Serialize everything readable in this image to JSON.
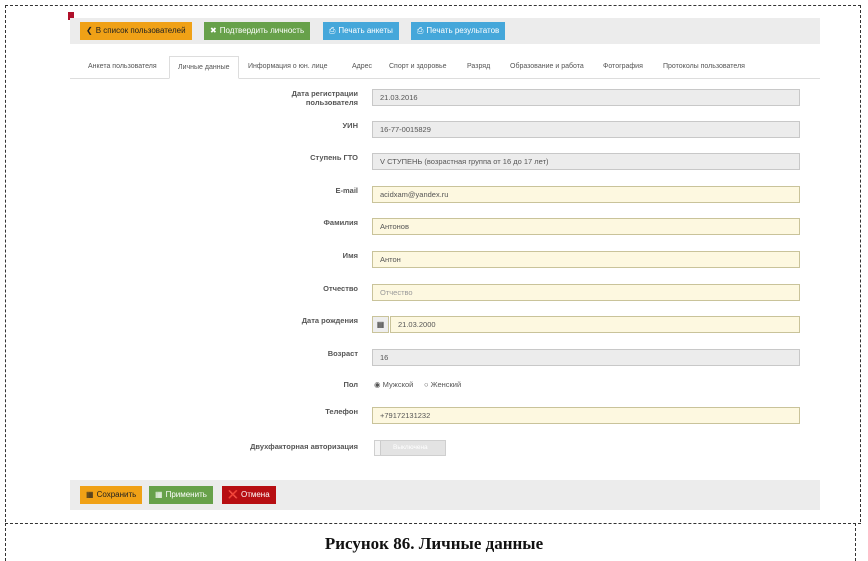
{
  "toolbar": {
    "back_label": "В список пользователей",
    "confirm_label": "Подтвердить личность",
    "print_form_label": "Печать анкеты",
    "print_results_label": "Печать результатов"
  },
  "tabs": [
    {
      "label": "Анкета пользователя",
      "active": false
    },
    {
      "label": "Личные данные",
      "active": true
    },
    {
      "label": "Информация о юн. лице",
      "active": false
    },
    {
      "label": "Адрес",
      "active": false
    },
    {
      "label": "Спорт и здоровье",
      "active": false
    },
    {
      "label": "Разряд",
      "active": false
    },
    {
      "label": "Образование и работа",
      "active": false
    },
    {
      "label": "Фотография",
      "active": false
    },
    {
      "label": "Протоколы пользователя",
      "active": false
    }
  ],
  "form": {
    "reg_date": {
      "label": "Дата регистрации пользователя",
      "value": "21.03.2016"
    },
    "uin": {
      "label": "УИН",
      "value": "16-77-0015829"
    },
    "gto_stage": {
      "label": "Ступень ГТО",
      "value": "V СТУПЕНЬ (возрастная группа от 16 до 17 лет)"
    },
    "email": {
      "label": "E-mail",
      "value": "acidxam@yandex.ru"
    },
    "last_name": {
      "label": "Фамилия",
      "value": "Антонов"
    },
    "first_name": {
      "label": "Имя",
      "value": "Антон"
    },
    "patronymic": {
      "label": "Отчество",
      "placeholder": "Отчество"
    },
    "birth_date": {
      "label": "Дата рождения",
      "value": "21.03.2000"
    },
    "age": {
      "label": "Возраст",
      "value": "16"
    },
    "gender": {
      "label": "Пол",
      "male": "Мужской",
      "female": "Женский",
      "selected": "Мужской"
    },
    "phone": {
      "label": "Телефон",
      "value": "+79172131232"
    },
    "two_factor": {
      "label": "Двухфакторная авторизация",
      "state_text": "Выключена"
    }
  },
  "footer": {
    "save_label": "Сохранить",
    "apply_label": "Применить",
    "cancel_label": "Отмена"
  },
  "caption": "Рисунок 86. Личные данные",
  "colors": {
    "orange": "#f0a116",
    "green": "#67a14a",
    "blue": "#45a7da",
    "red": "#b70e12",
    "editable_bg": "#fdf8e0",
    "readonly_bg": "#ececec"
  }
}
